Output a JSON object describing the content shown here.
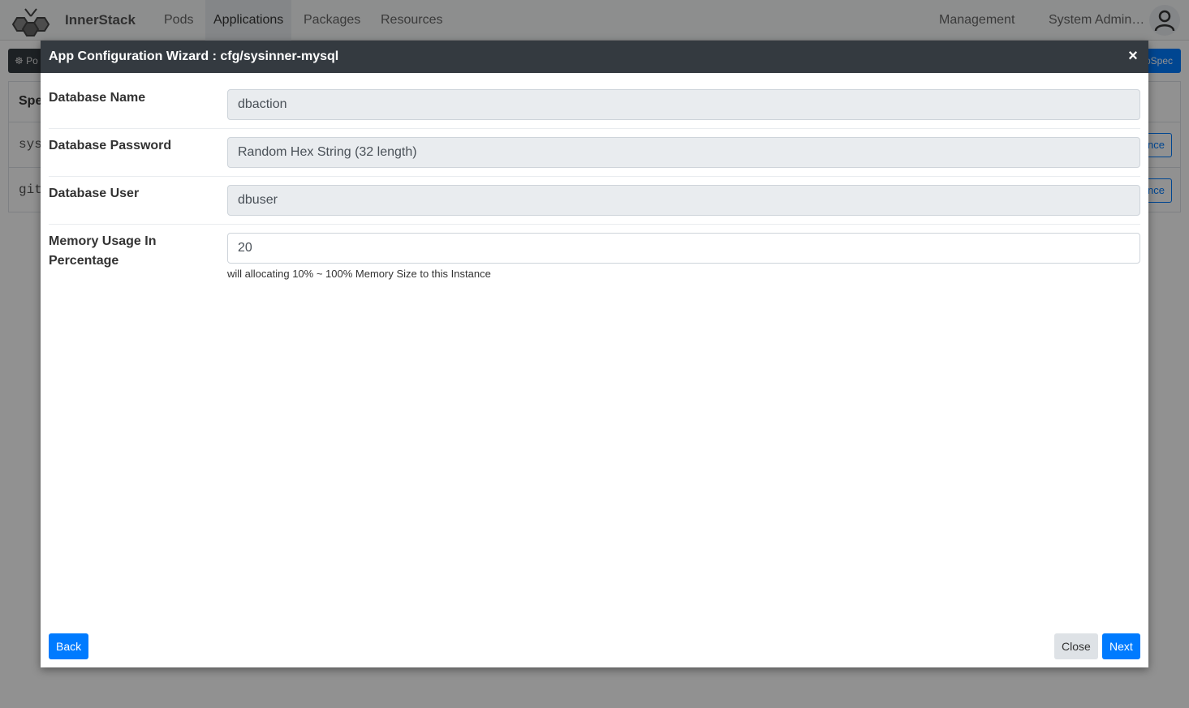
{
  "navbar": {
    "brand": "InnerStack",
    "items": [
      {
        "label": "Pods",
        "active": false
      },
      {
        "label": "Applications",
        "active": true
      },
      {
        "label": "Packages",
        "active": false
      },
      {
        "label": "Resources",
        "active": false
      }
    ],
    "management": "Management",
    "user": "System Admin…"
  },
  "background": {
    "pod_button": "Po",
    "spec_button": "AppSpec",
    "table_header": "Spec",
    "rows": [
      {
        "name": "sys",
        "action": "Instance"
      },
      {
        "name": "git",
        "action": "Instance"
      }
    ]
  },
  "modal": {
    "title": "App Configuration Wizard : cfg/sysinner-mysql",
    "close_symbol": "×",
    "fields": [
      {
        "label": "Database Name",
        "value": "dbaction",
        "readonly": true
      },
      {
        "label": "Database Password",
        "value": "Random Hex String (32 length)",
        "readonly": true
      },
      {
        "label": "Database User",
        "value": "dbuser",
        "readonly": true
      },
      {
        "label": "Memory Usage In Percentage",
        "value": "20",
        "readonly": false,
        "help": "will allocating 10% ~ 100% Memory Size to this Instance"
      }
    ],
    "buttons": {
      "back": "Back",
      "close": "Close",
      "next": "Next"
    }
  },
  "colors": {
    "primary": "#007bff",
    "header_dark": "#343a40"
  }
}
